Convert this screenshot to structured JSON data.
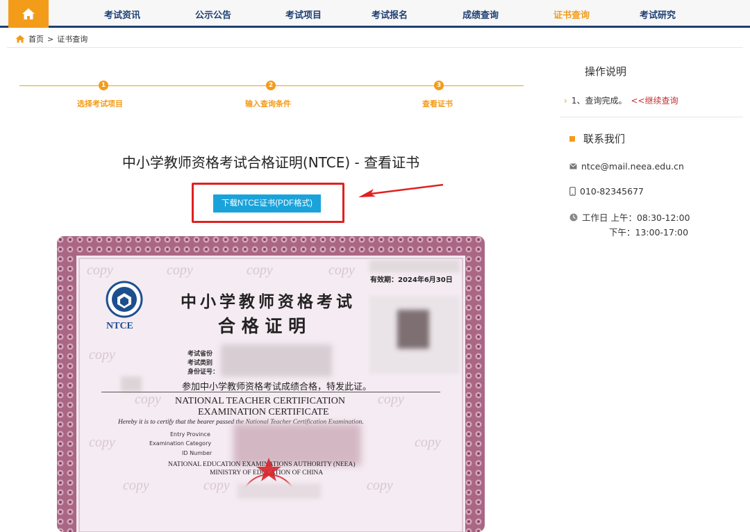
{
  "nav": {
    "items": [
      "考试资讯",
      "公示公告",
      "考试项目",
      "考试报名",
      "成绩查询",
      "证书查询",
      "考试研究"
    ],
    "active_index": 5
  },
  "breadcrumb": {
    "home": "首页",
    "separator": ">",
    "current": "证书查询"
  },
  "steps": {
    "labels": [
      "选择考试项目",
      "输入查询条件",
      "查看证书"
    ],
    "numbers": [
      "1",
      "2",
      "3"
    ]
  },
  "main": {
    "title": "中小学教师资格考试合格证明(NTCE) - 查看证书",
    "download_label": "下载NTCE证书(PDF格式)"
  },
  "certificate": {
    "validity": "有效期：2024年6月30日",
    "title_cn_1": "中小学教师资格考试",
    "title_cn_2": "合 格 证 明",
    "logo_text": "NTCE",
    "watermark": "copy",
    "field_1": "考试省份",
    "field_2": "考试类别",
    "field_3": "身份证号：",
    "statement_cn": "参加中小学教师资格考试成绩合格，特发此证。",
    "title_en_1": "NATIONAL TEACHER CERTIFICATION",
    "title_en_2": "EXAMINATION CERTIFICATE",
    "statement_en": "Hereby it is to certify that the bearer passed the National Teacher Certification Examination.",
    "field_en_1": "Entry Province",
    "field_en_2": "Examination Category",
    "field_en_3": "ID Number",
    "authority_1": "NATIONAL EDUCATION EXAMINATIONS AUTHORITY (NEEA)",
    "authority_2": "MINISTRY OF EDUCATION OF CHINA"
  },
  "side": {
    "op_title": "操作说明",
    "op_chevron": "›",
    "op_text": "1、查询完成。",
    "continue_link": "<<继续查询",
    "contact_title": "联系我们",
    "email": "ntce@mail.neea.edu.cn",
    "phone": "010-82345677",
    "hours_line1": "工作日 上午：08:30-12:00",
    "hours_line2": "下午：13:00-17:00"
  },
  "colors": {
    "accent": "#f39c1a",
    "nav_text": "#1e3f73",
    "button": "#1aa3db",
    "highlight_red": "#e02020"
  }
}
